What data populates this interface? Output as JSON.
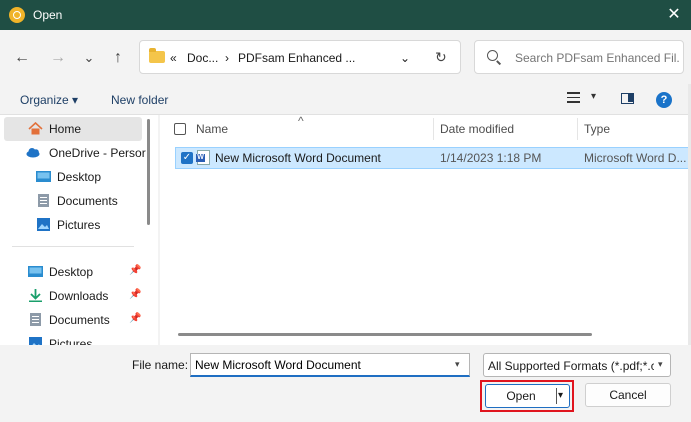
{
  "window": {
    "title": "Open",
    "close_glyph": "✕"
  },
  "nav": {
    "back": "←",
    "forward": "→",
    "recent": "⌄",
    "up": "↑"
  },
  "address": {
    "overflow": "«",
    "crumbs": [
      "Doc...",
      "PDFsam Enhanced ..."
    ],
    "separator": "›",
    "dropdown": "⌄",
    "refresh": "↻"
  },
  "search": {
    "placeholder": "Search PDFsam Enhanced Fil..."
  },
  "commands": {
    "organize": "Organize ▾",
    "new_folder": "New folder",
    "view_caret": "▾",
    "help": "?"
  },
  "sidebar": {
    "items": [
      {
        "label": "Home",
        "icon": "home-icon"
      },
      {
        "label": "OneDrive - Persor",
        "icon": "cloud-icon"
      },
      {
        "label": "Desktop",
        "icon": "desktop-icon"
      },
      {
        "label": "Documents",
        "icon": "documents-icon"
      },
      {
        "label": "Pictures",
        "icon": "pictures-icon"
      },
      {
        "label": "Desktop",
        "icon": "desktop-icon",
        "pinned": true
      },
      {
        "label": "Downloads",
        "icon": "download-icon",
        "pinned": true
      },
      {
        "label": "Documents",
        "icon": "documents-icon",
        "pinned": true
      },
      {
        "label": "Pictures",
        "icon": "pictures-icon",
        "pinned": true
      }
    ],
    "pin_glyph": "📌"
  },
  "columns": {
    "name": "Name",
    "date": "Date modified",
    "type": "Type",
    "sort_glyph": "^"
  },
  "files": [
    {
      "name": "New Microsoft Word Document",
      "date": "1/14/2023 1:18 PM",
      "type": "Microsoft Word D...",
      "selected": true
    }
  ],
  "footer": {
    "filename_label": "File name:",
    "filename_value": "New Microsoft Word Document",
    "filter": "All Supported Formats (*.pdf;*.c",
    "open": "Open",
    "cancel": "Cancel",
    "caret": "▾",
    "check": "✓"
  },
  "colors": {
    "titlebar": "#1f4e44",
    "accent": "#1f6ec2",
    "highlight": "#e0141e",
    "selection": "#cce8ff"
  }
}
